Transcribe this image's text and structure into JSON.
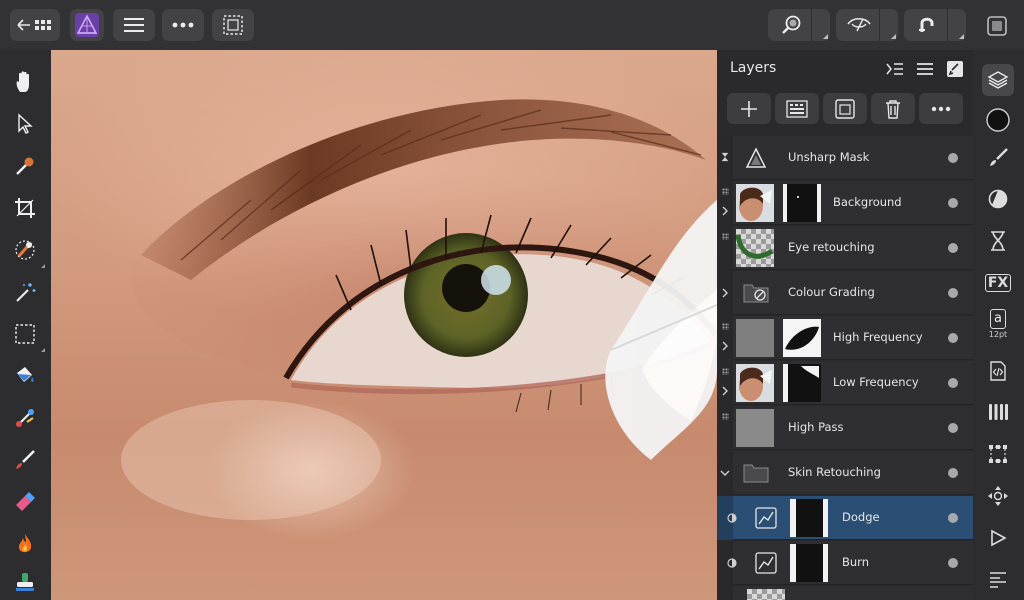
{
  "toolbar": {
    "back_icon": "back-grid-icon",
    "app_icon": "affinity-photo-icon",
    "colors": {
      "app_icon_bg": "#6a3fa8",
      "selection_blue": "#2a4e74"
    }
  },
  "layers_panel": {
    "title": "Layers",
    "layers": [
      {
        "name": "Unsharp Mask",
        "kind": "filter"
      },
      {
        "name": "Background",
        "kind": "pixel-masked"
      },
      {
        "name": "Eye retouching",
        "kind": "pixel"
      },
      {
        "name": "Colour Grading",
        "kind": "group-adjust"
      },
      {
        "name": "High Frequency",
        "kind": "pixel-masked"
      },
      {
        "name": "Low Frequency",
        "kind": "pixel-masked"
      },
      {
        "name": "High Pass",
        "kind": "pixel"
      },
      {
        "name": "Skin Retouching",
        "kind": "group"
      },
      {
        "name": "Dodge",
        "kind": "curves-masked",
        "selected": true
      },
      {
        "name": "Burn",
        "kind": "curves-masked"
      }
    ]
  },
  "studio": {
    "text_style_label": "12pt",
    "text_style_glyph": "a",
    "fx_label": "FX"
  }
}
